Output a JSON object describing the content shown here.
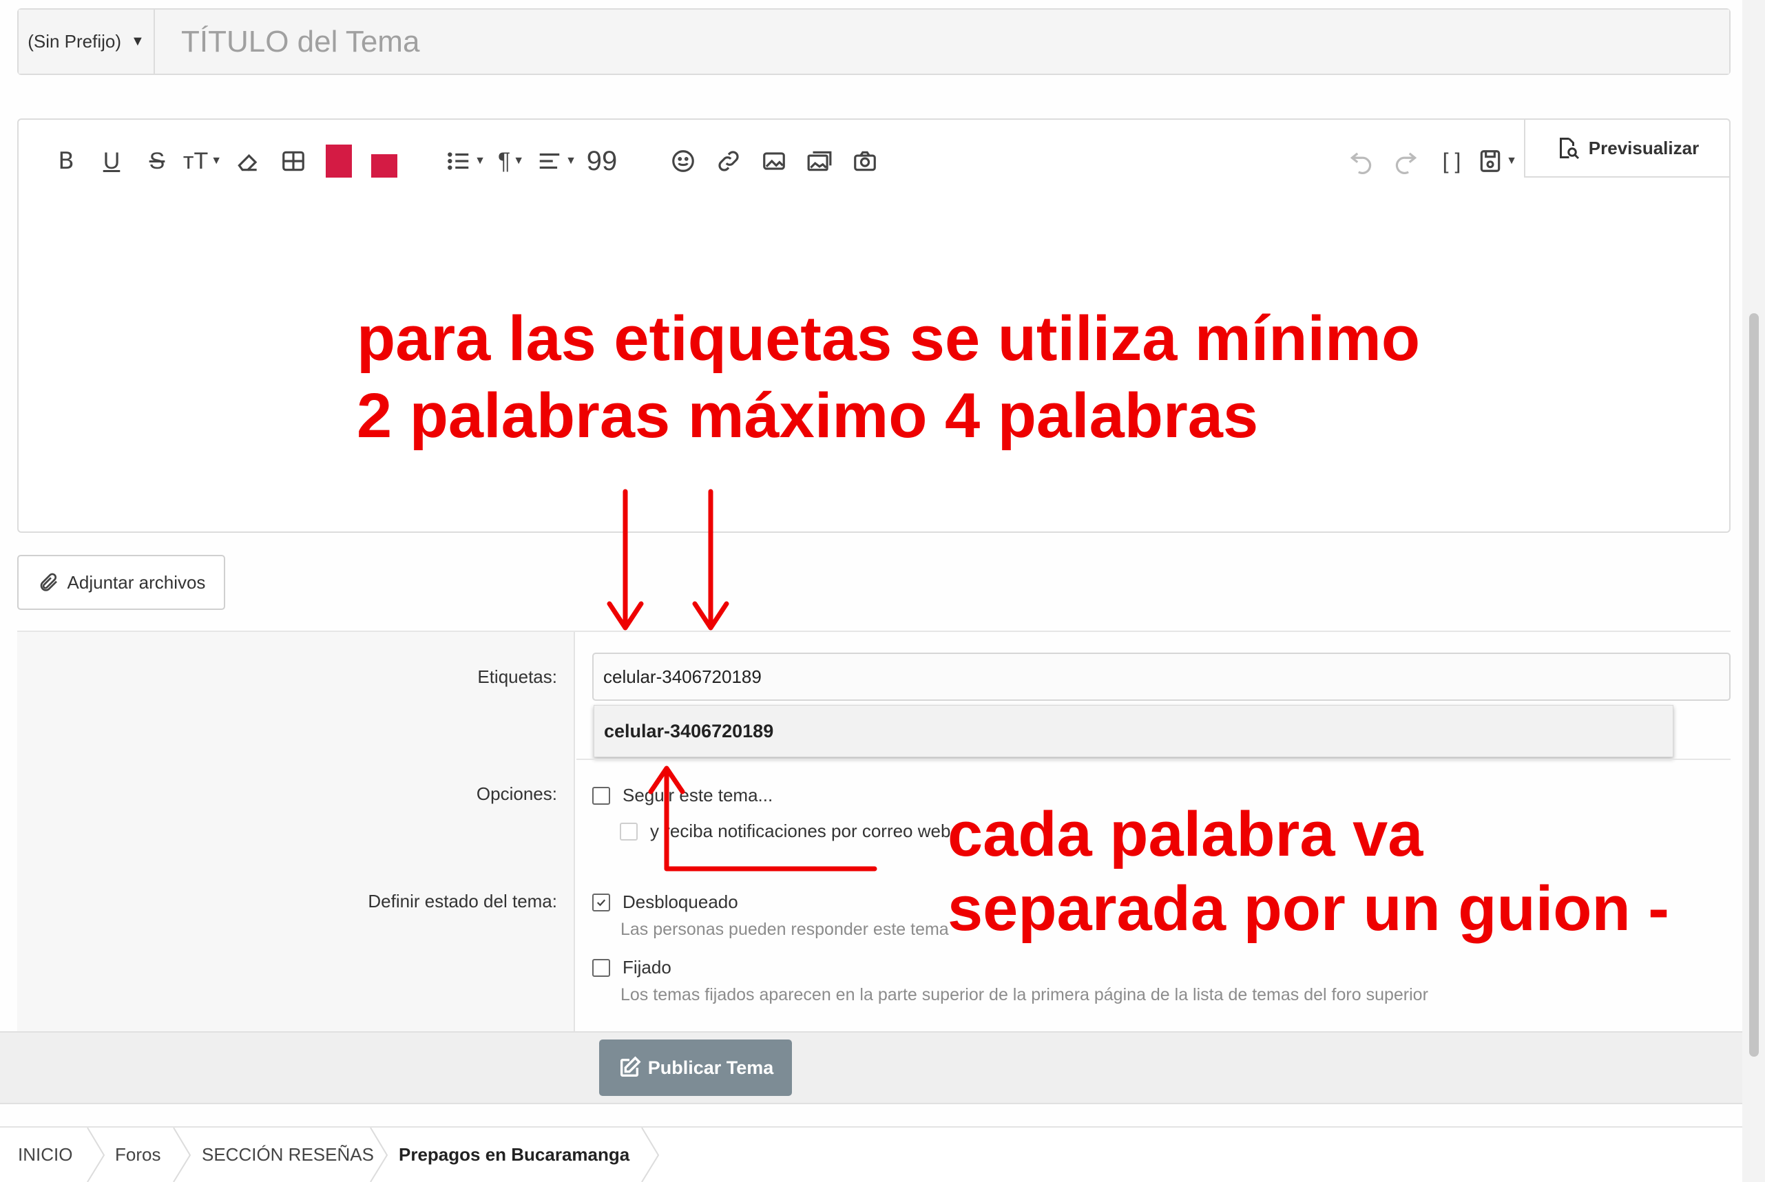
{
  "title_row": {
    "prefix_label": "(Sin Prefijo)",
    "title_placeholder": "TÍTULO del Tema"
  },
  "editor": {
    "toolbar_icons": [
      "bold-icon",
      "underline-icon",
      "strikethrough-icon",
      "font-size-icon",
      "eraser-icon",
      "table-icon",
      "text-color-swatch",
      "background-color-swatch",
      "list-icon",
      "paragraph-icon",
      "align-icon",
      "quote-icon",
      "emoji-icon",
      "link-icon",
      "image-icon",
      "media-icon",
      "camera-icon",
      "undo-icon",
      "redo-icon",
      "code-brackets-icon",
      "save-draft-icon"
    ],
    "preview_label": "Previsualizar",
    "swatch_color": "#d41b44"
  },
  "attach": {
    "label": "Adjuntar archivos"
  },
  "form": {
    "tags_label": "Etiquetas:",
    "tags_value": "celular-3406720189",
    "suggestion": "celular-3406720189",
    "options_label": "Opciones:",
    "watch_label": "Seguir este tema...",
    "email_label": "y reciba notificaciones por correo web",
    "state_label": "Definir estado del tema:",
    "unlocked_label": "Desbloqueado",
    "unlocked_hint": "Las personas pueden responder este tema",
    "sticky_label": "Fijado",
    "sticky_hint": "Los temas fijados aparecen en la parte superior de la primera página de la lista de temas del foro superior"
  },
  "submit": {
    "label": "Publicar Tema"
  },
  "breadcrumb": [
    "INICIO",
    "Foros",
    "SECCIÓN RESEÑAS",
    "Prepagos en Bucaramanga"
  ],
  "annotations": {
    "top_line1": "para las etiquetas se utiliza mínimo",
    "top_line2": "2 palabras máximo 4 palabras",
    "bottom_line1": "cada palabra va",
    "bottom_line2": "separada por un guion -",
    "color": "#ee0000"
  }
}
